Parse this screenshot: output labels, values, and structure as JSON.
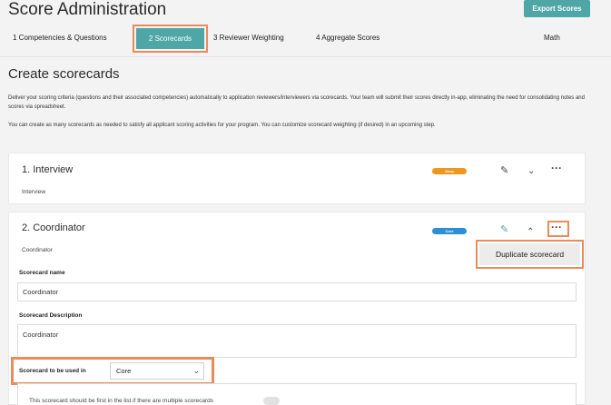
{
  "header": {
    "title": "Score Administration",
    "export_label": "Export Scores"
  },
  "tabs": [
    {
      "label": "1 Competencies & Questions"
    },
    {
      "label": "2 Scorecards"
    },
    {
      "label": "3 Reviewer Weighting"
    },
    {
      "label": "4 Aggregate Scores"
    }
  ],
  "program": "Math",
  "section": {
    "title": "Create scorecards",
    "desc1": "Deliver your scoring criteria (questions and their associated competencies) automatically to application reviewers/interviewers via scorecards. Your team will submit their scores directly in-app, eliminating the need for consolidating notes and scores via spreadsheet.",
    "desc2": "You can create as many scorecards as needed to satisfy all applicant scoring activities for your program. You can customize scorecard weighting (if desired) in an upcoming step."
  },
  "scorecards": [
    {
      "title": "1. Interview",
      "subtitle": "Interview",
      "badge": "Seep",
      "badge_color": "#f0961c"
    },
    {
      "title": "2. Coordinator",
      "subtitle": "Coordinator",
      "badge": "Core",
      "badge_color": "#2b8ed6"
    }
  ],
  "menu": {
    "duplicate_label": "Duplicate scorecard"
  },
  "form": {
    "name_label": "Scorecard name",
    "name_value": "Coordinator",
    "description_label": "Scorecard Description",
    "description_value": "Coordinator",
    "used_in_label": "Scorecard to be used in",
    "used_in_value": "Core",
    "first_text": "This scorecard should be first in the list if there are multiple scorecards"
  },
  "icons": {
    "edit": "edit-icon",
    "chevron_down": "chevron-down-icon",
    "chevron_up": "chevron-up-icon",
    "more": "more-icon"
  },
  "colors": {
    "accent": "#4fa6a6",
    "highlight": "#ec8a5a"
  }
}
